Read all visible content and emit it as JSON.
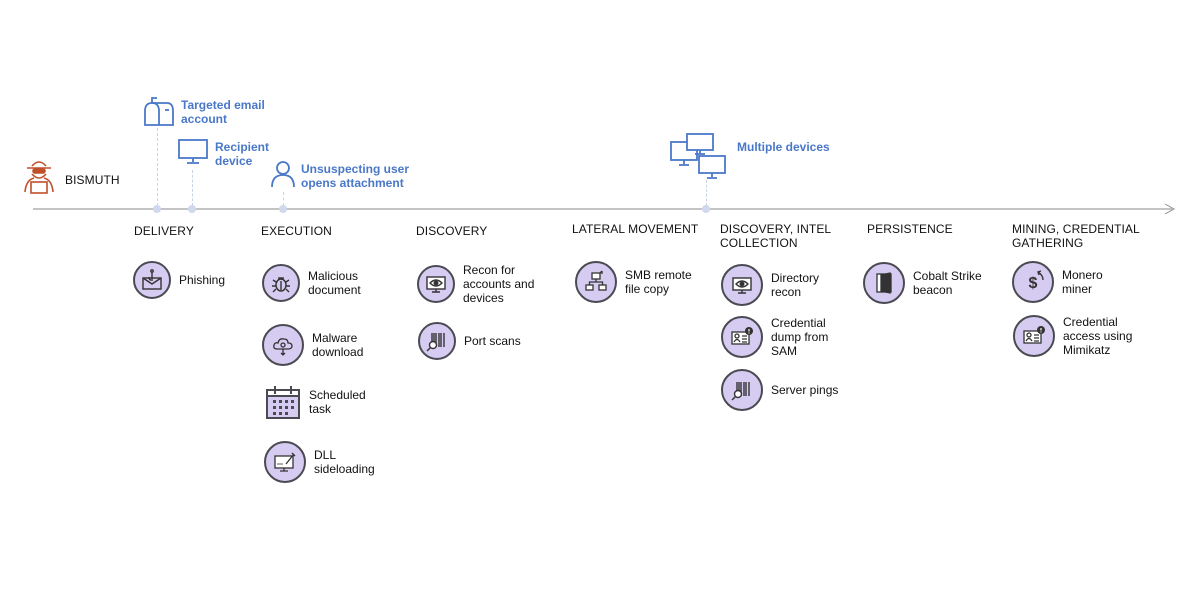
{
  "actor": {
    "name": "BISMUTH",
    "icon": "hacker-icon",
    "color": "#c0502a"
  },
  "accent_color": "#4a78c8",
  "timeline_events": [
    {
      "label": "Targeted email account",
      "icon": "mailbox-icon"
    },
    {
      "label": "Recipient device",
      "icon": "monitor-icon"
    },
    {
      "label": "Unsuspecting user opens attachment",
      "icon": "user-icon"
    },
    {
      "label": "Multiple devices",
      "icon": "multiple-monitors-icon"
    }
  ],
  "phases": [
    {
      "title": "DELIVERY",
      "items": [
        {
          "label": "Phishing",
          "icon": "phishing-icon"
        }
      ]
    },
    {
      "title": "EXECUTION",
      "items": [
        {
          "label": "Malicious document",
          "icon": "bug-icon"
        },
        {
          "label": "Malware download",
          "icon": "cloud-download-icon"
        },
        {
          "label": "Scheduled task",
          "icon": "calendar-icon"
        },
        {
          "label": "DLL sideloading",
          "icon": "dll-injection-icon"
        }
      ]
    },
    {
      "title": "DISCOVERY",
      "items": [
        {
          "label": "Recon for accounts and devices",
          "icon": "eye-monitor-icon"
        },
        {
          "label": "Port scans",
          "icon": "barcode-scan-icon"
        }
      ]
    },
    {
      "title": "LATERAL MOVEMENT",
      "items": [
        {
          "label": "SMB remote file copy",
          "icon": "network-icon"
        }
      ]
    },
    {
      "title": "DISCOVERY, INTEL COLLECTION",
      "items": [
        {
          "label": "Directory recon",
          "icon": "eye-monitor-icon"
        },
        {
          "label": "Credential dump from SAM",
          "icon": "id-card-alert-icon"
        },
        {
          "label": "Server pings",
          "icon": "barcode-scan-icon"
        }
      ]
    },
    {
      "title": "PERSISTENCE",
      "items": [
        {
          "label": "Cobalt Strike beacon",
          "icon": "door-icon"
        }
      ]
    },
    {
      "title": "MINING, CREDENTIAL GATHERING",
      "items": [
        {
          "label": "Monero miner",
          "icon": "dollar-cycle-icon"
        },
        {
          "label": "Credential access using Mimikatz",
          "icon": "id-card-alert-icon"
        }
      ]
    }
  ]
}
